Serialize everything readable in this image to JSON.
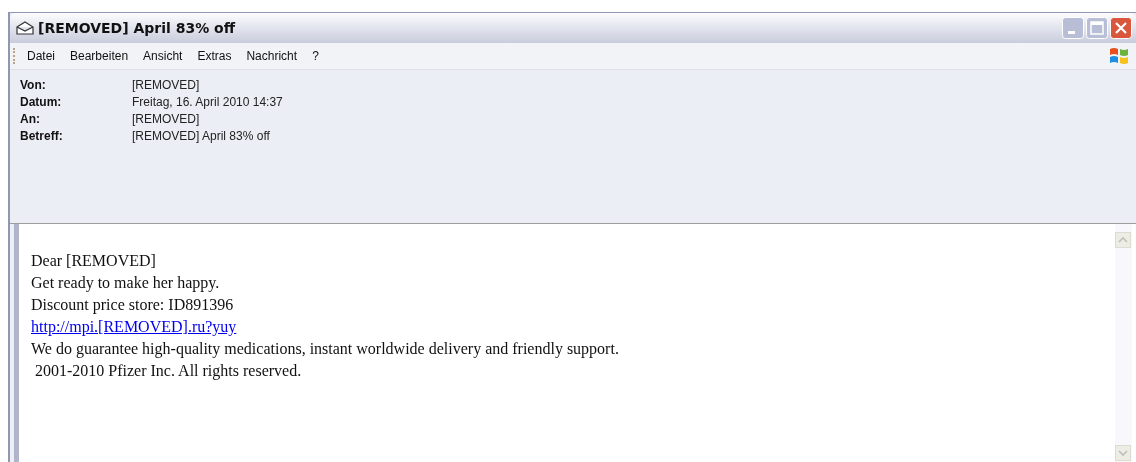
{
  "window": {
    "title": "[REMOVED] April 83% off"
  },
  "menu": [
    {
      "label": "Datei"
    },
    {
      "label": "Bearbeiten"
    },
    {
      "label": "Ansicht"
    },
    {
      "label": "Extras"
    },
    {
      "label": "Nachricht"
    },
    {
      "label": "?"
    }
  ],
  "headers": [
    {
      "label": "Von:",
      "value": "[REMOVED]"
    },
    {
      "label": "Datum:",
      "value": "Freitag, 16. April 2010 14:37"
    },
    {
      "label": "An:",
      "value": "[REMOVED]"
    },
    {
      "label": "Betreff:",
      "value": "[REMOVED] April 83% off"
    }
  ],
  "body": [
    {
      "kind": "text",
      "text": "Dear [REMOVED]"
    },
    {
      "kind": "text",
      "text": "Get ready to make her happy."
    },
    {
      "kind": "text",
      "text": "Discount price store: ID891396"
    },
    {
      "kind": "link",
      "text": "http://mpi.[REMOVED].ru?yuy"
    },
    {
      "kind": "text",
      "text": "We do guarantee high-quality medications, instant worldwide delivery and friendly support."
    },
    {
      "kind": "text",
      "text": " 2001-2010 Pfizer Inc. All rights reserved."
    }
  ]
}
